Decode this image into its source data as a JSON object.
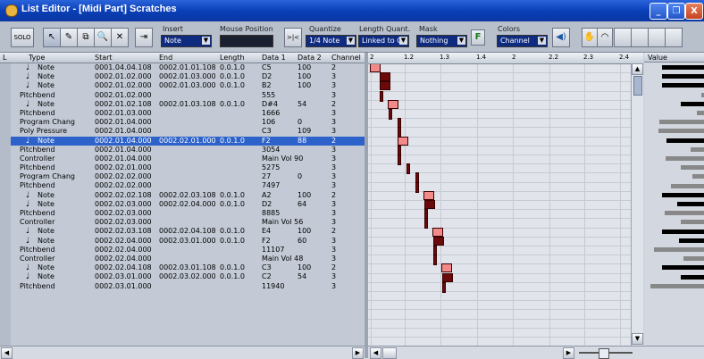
{
  "window": {
    "title": "List Editor - [Midi Part] Scratches",
    "minimize_glyph": "_",
    "restore_glyph": "❐",
    "close_glyph": "X"
  },
  "toolbar": {
    "solo_label": "SOLO",
    "tool_glyphs": [
      "↖",
      "✎",
      "⧉",
      "🔍",
      "✕",
      "⇥"
    ],
    "insert_label": "Insert",
    "insert_value": "Note",
    "mouse_label": "Mouse Position",
    "quantize_label": "Quantize",
    "quantize_value": "1/4 Note",
    "length_label": "Length Quant.",
    "length_value": "Linked to Q",
    "mask_label": "Mask",
    "mask_value": "Nothing",
    "filter_label": "F",
    "colors_label": "Colors",
    "colors_value": "Channel",
    "snap_glyph": ">|<"
  },
  "columns": {
    "l": "L",
    "type": "Type",
    "start": "Start",
    "end": "End",
    "length": "Length",
    "data1": "Data 1",
    "data2": "Data 2",
    "channel": "Channel"
  },
  "value_header": "Value",
  "rows": [
    {
      "type": "Note",
      "start": "0001.04.04.108",
      "end": "0002.01.01.108",
      "length": "0.0.1.0",
      "d1": "C5",
      "d2": "100",
      "ch": "2",
      "note": true
    },
    {
      "type": "Note",
      "start": "0002.01.02.000",
      "end": "0002.01.03.000",
      "length": "0.0.1.0",
      "d1": "D2",
      "d2": "100",
      "ch": "3",
      "note": true
    },
    {
      "type": "Note",
      "start": "0002.01.02.000",
      "end": "0002.01.03.000",
      "length": "0.0.1.0",
      "d1": "B2",
      "d2": "100",
      "ch": "3",
      "note": true
    },
    {
      "type": "Pitchbend",
      "start": "0002.01.02.000",
      "end": "",
      "length": "",
      "d1": "555",
      "d2": "",
      "ch": "3",
      "note": false
    },
    {
      "type": "Note",
      "start": "0002.01.02.108",
      "end": "0002.01.03.108",
      "length": "0.0.1.0",
      "d1": "D#4",
      "d2": "54",
      "ch": "2",
      "note": true
    },
    {
      "type": "Pitchbend",
      "start": "0002.01.03.000",
      "end": "",
      "length": "",
      "d1": "1666",
      "d2": "",
      "ch": "3",
      "note": false
    },
    {
      "type": "Program Chang",
      "start": "0002.01.04.000",
      "end": "",
      "length": "",
      "d1": "106",
      "d2": "0",
      "ch": "3",
      "note": false
    },
    {
      "type": "Poly Pressure",
      "start": "0002.01.04.000",
      "end": "",
      "length": "",
      "d1": "C3",
      "d2": "109",
      "ch": "3",
      "note": false
    },
    {
      "type": "Note",
      "start": "0002.01.04.000",
      "end": "0002.02.01.000",
      "length": "0.0.1.0",
      "d1": "F2",
      "d2": "88",
      "ch": "2",
      "note": true,
      "selected": true
    },
    {
      "type": "Pitchbend",
      "start": "0002.01.04.000",
      "end": "",
      "length": "",
      "d1": "3054",
      "d2": "",
      "ch": "3",
      "note": false
    },
    {
      "type": "Controller",
      "start": "0002.01.04.000",
      "end": "",
      "length": "",
      "d1": "Main Vol 90",
      "d2": "",
      "ch": "3",
      "note": false
    },
    {
      "type": "Pitchbend",
      "start": "0002.02.01.000",
      "end": "",
      "length": "",
      "d1": "5275",
      "d2": "",
      "ch": "3",
      "note": false
    },
    {
      "type": "Program Chang",
      "start": "0002.02.02.000",
      "end": "",
      "length": "",
      "d1": "27",
      "d2": "0",
      "ch": "3",
      "note": false
    },
    {
      "type": "Pitchbend",
      "start": "0002.02.02.000",
      "end": "",
      "length": "",
      "d1": "7497",
      "d2": "",
      "ch": "3",
      "note": false
    },
    {
      "type": "Note",
      "start": "0002.02.02.108",
      "end": "0002.02.03.108",
      "length": "0.0.1.0",
      "d1": "A2",
      "d2": "100",
      "ch": "2",
      "note": true
    },
    {
      "type": "Note",
      "start": "0002.02.03.000",
      "end": "0002.02.04.000",
      "length": "0.0.1.0",
      "d1": "D2",
      "d2": "64",
      "ch": "3",
      "note": true
    },
    {
      "type": "Pitchbend",
      "start": "0002.02.03.000",
      "end": "",
      "length": "",
      "d1": "8885",
      "d2": "",
      "ch": "3",
      "note": false
    },
    {
      "type": "Controller",
      "start": "0002.02.03.000",
      "end": "",
      "length": "",
      "d1": "Main Vol 56",
      "d2": "",
      "ch": "3",
      "note": false
    },
    {
      "type": "Note",
      "start": "0002.02.03.108",
      "end": "0002.02.04.108",
      "length": "0.0.1.0",
      "d1": "E4",
      "d2": "100",
      "ch": "2",
      "note": true
    },
    {
      "type": "Note",
      "start": "0002.02.04.000",
      "end": "0002.03.01.000",
      "length": "0.0.1.0",
      "d1": "F2",
      "d2": "60",
      "ch": "3",
      "note": true
    },
    {
      "type": "Pitchbend",
      "start": "0002.02.04.000",
      "end": "",
      "length": "",
      "d1": "11107",
      "d2": "",
      "ch": "3",
      "note": false
    },
    {
      "type": "Controller",
      "start": "0002.02.04.000",
      "end": "",
      "length": "",
      "d1": "Main Vol 48",
      "d2": "",
      "ch": "3",
      "note": false
    },
    {
      "type": "Note",
      "start": "0002.02.04.108",
      "end": "0002.03.01.108",
      "length": "0.0.1.0",
      "d1": "C3",
      "d2": "100",
      "ch": "2",
      "note": true
    },
    {
      "type": "Note",
      "start": "0002.03.01.000",
      "end": "0002.03.02.000",
      "length": "0.0.1.0",
      "d1": "C2",
      "d2": "54",
      "ch": "3",
      "note": true
    },
    {
      "type": "Pitchbend",
      "start": "0002.03.01.000",
      "end": "",
      "length": "",
      "d1": "11940",
      "d2": "",
      "ch": "3",
      "note": false
    }
  ],
  "ruler_ticks": [
    "2",
    "1.2",
    "1.3",
    "1.4",
    "2",
    "2.2",
    "2.3",
    "2.4"
  ],
  "colors": {
    "channel2": "#f28a8a",
    "channel3": "#6a0a0a",
    "selection": "#2c62c9"
  }
}
